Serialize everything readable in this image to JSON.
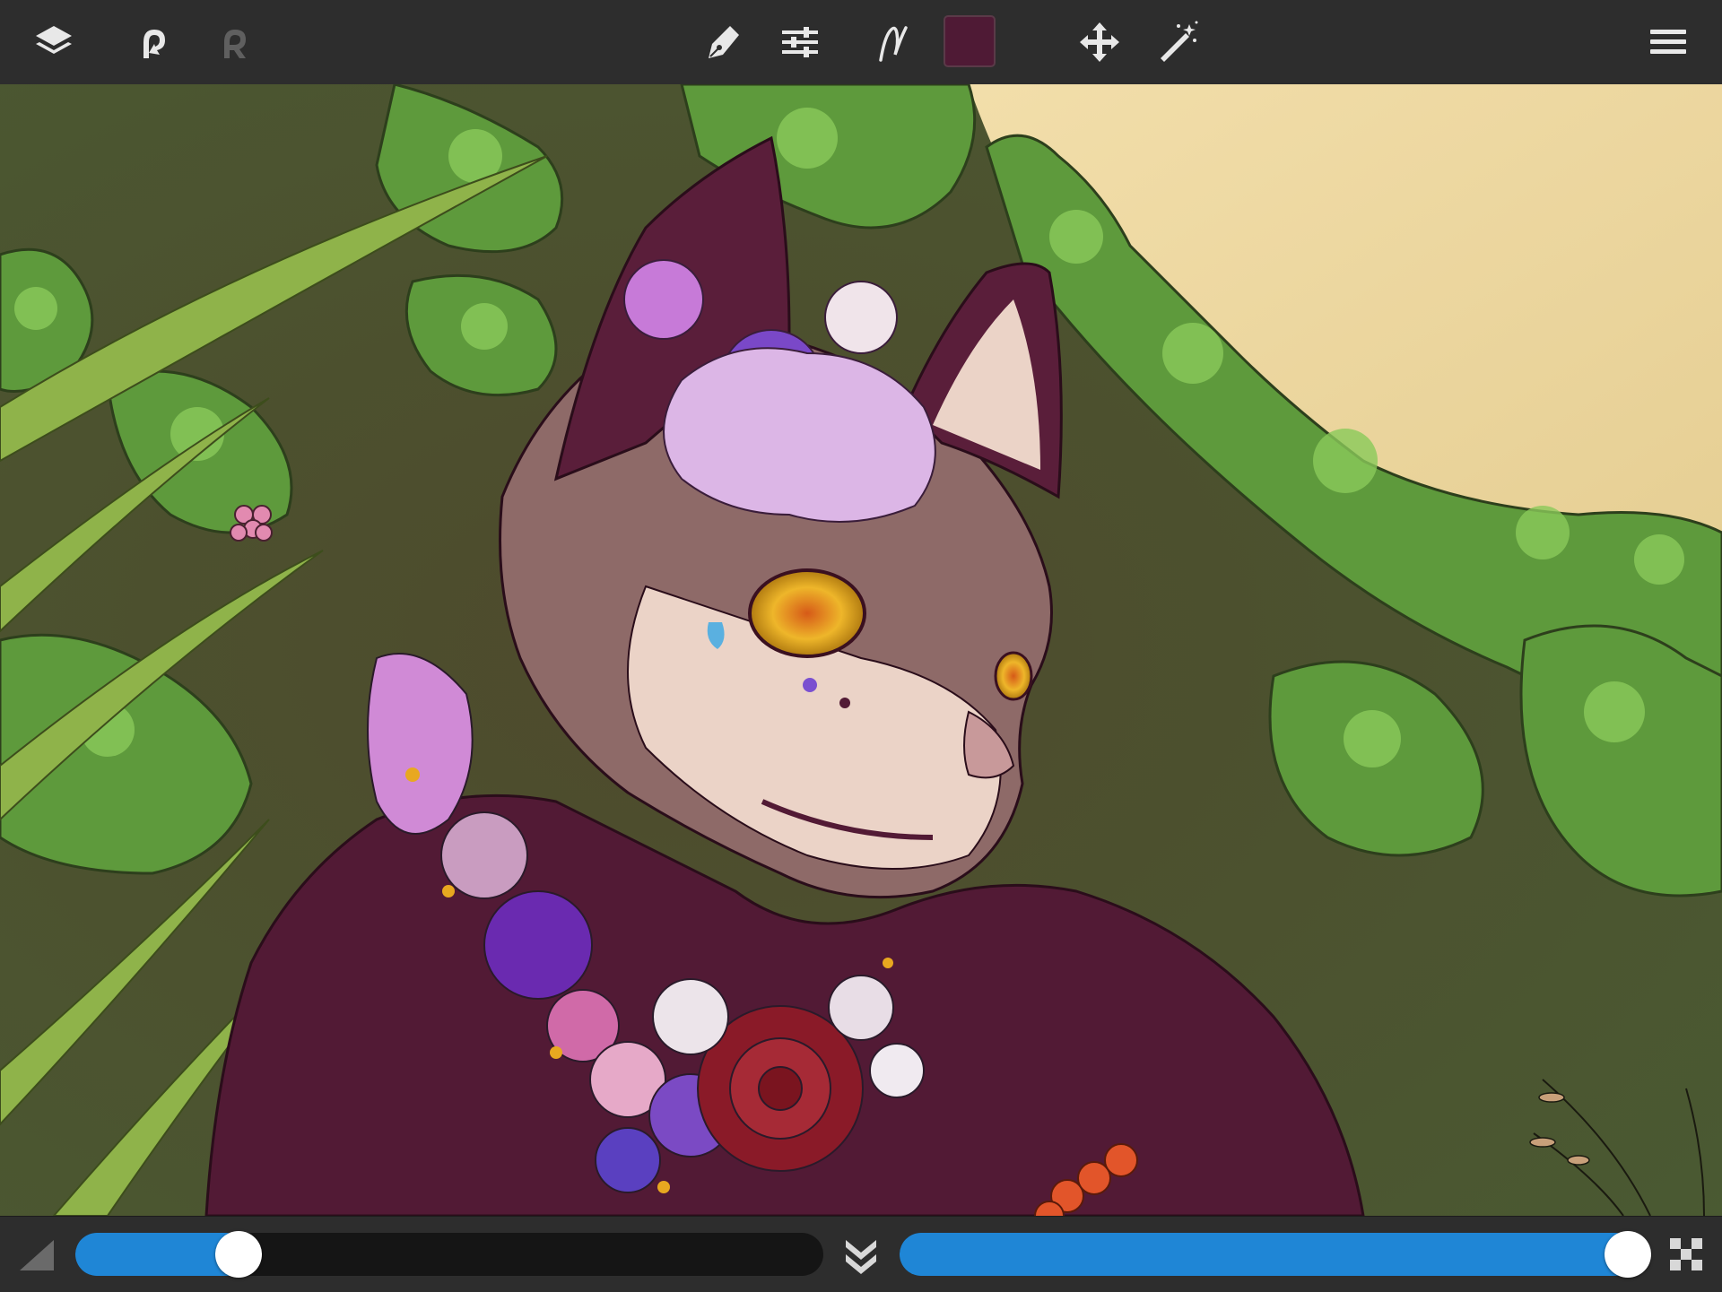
{
  "toolbar": {
    "left_tools": [
      "layers-icon",
      "undo-icon",
      "redo-icon"
    ],
    "center_tools": [
      "pen-icon",
      "adjustments-icon",
      "brush-stroke-icon",
      "move-icon",
      "magic-wand-icon"
    ],
    "right_tools": [
      "menu-icon"
    ],
    "current_color": "#4f1a35"
  },
  "canvas": {
    "description_free": true
  },
  "bottom": {
    "brush_size_percent": 20,
    "brush_opacity_percent": 100,
    "accent_color": "#1f86d6"
  }
}
